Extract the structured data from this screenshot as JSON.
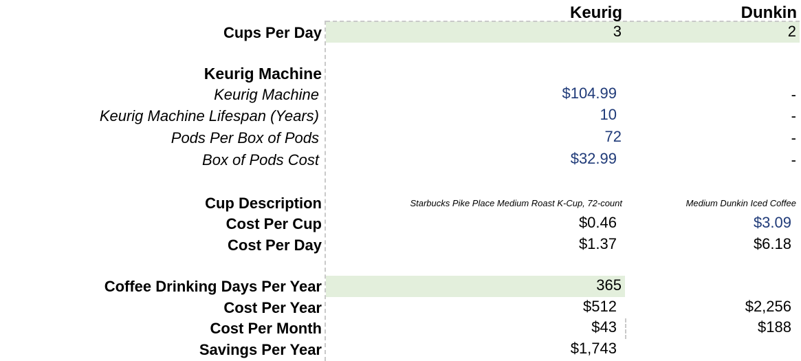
{
  "header": {
    "keurig": "Keurig",
    "dunkin": "Dunkin"
  },
  "rows": {
    "cups_per_day": {
      "label": "Cups Per Day",
      "keurig": "3",
      "dunkin": "2"
    },
    "keurig_machine_heading": {
      "label": "Keurig Machine"
    },
    "keurig_machine": {
      "label": "Keurig Machine",
      "keurig": "$104.99",
      "dunkin": "-"
    },
    "lifespan": {
      "label": "Keurig Machine Lifespan (Years)",
      "keurig": "10",
      "dunkin": "-"
    },
    "pods_per_box": {
      "label": "Pods Per Box of Pods",
      "keurig": "72",
      "dunkin": "-"
    },
    "box_cost": {
      "label": "Box of Pods Cost",
      "keurig": "$32.99",
      "dunkin": "-"
    },
    "cup_description": {
      "label": "Cup Description",
      "keurig": "Starbucks Pike Place Medium Roast K-Cup, 72-count",
      "dunkin": "Medium Dunkin Iced Coffee"
    },
    "cost_per_cup": {
      "label": "Cost Per Cup",
      "keurig": "$0.46",
      "dunkin": "$3.09"
    },
    "cost_per_day": {
      "label": "Cost Per Day",
      "keurig": "$1.37",
      "dunkin": "$6.18"
    },
    "days_per_year": {
      "label": "Coffee Drinking Days Per Year",
      "keurig": "365"
    },
    "cost_per_year": {
      "label": "Cost Per Year",
      "keurig": "$512",
      "dunkin": "$2,256"
    },
    "cost_per_month": {
      "label": "Cost Per Month",
      "keurig": "$43",
      "dunkin": "$188"
    },
    "savings_per_year": {
      "label": "Savings Per Year",
      "keurig": "$1,743"
    }
  },
  "colors": {
    "input_highlight": "#e3efdc",
    "input_blue": "#1f3a78",
    "dashed_border": "#c9c9c9"
  }
}
